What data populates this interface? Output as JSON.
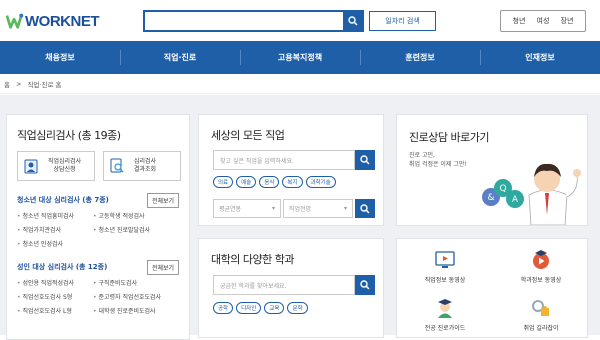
{
  "header": {
    "logo_text": "WORKNET",
    "search_placeholder": "",
    "job_search_label": "일자리 검색",
    "audience": [
      "청년",
      "여성",
      "장년"
    ]
  },
  "nav": [
    "채용정보",
    "직업·진로",
    "고용복지정책",
    "훈련정보",
    "인재정보"
  ],
  "breadcrumb": [
    "홈",
    ">",
    "직업·진로 홈"
  ],
  "psych": {
    "title": "직업심리검사 (총 19종)",
    "btn_apply": "직업심리검사\n상담신청",
    "btn_apply_l1": "직업심리검사",
    "btn_apply_l2": "상담신청",
    "btn_result_l1": "심리검사",
    "btn_result_l2": "결과조회",
    "youth_title": "청소년 대상 심리검사 (총 7종)",
    "youth_all": "전체보기",
    "youth_items": [
      "청소년 직업흥미검사",
      "고등학생 적성검사",
      "직업가치관검사",
      "청소년 진로발달검사",
      "청소년 인성검사"
    ],
    "adult_title": "성인 대상 심리검사 (총 12종)",
    "adult_all": "전체보기",
    "adult_items": [
      "성인용 직업적성검사",
      "구직준비도검사",
      "직업선호도검사 S형",
      "준고령자 직업선호도검사",
      "직업선호도검사 L형",
      "대학생 진로준비도검사"
    ]
  },
  "jobs": {
    "title": "세상의 모든 직업",
    "placeholder": "찾고 싶은 직업을 입력하세요.",
    "tags": [
      "의료",
      "예술",
      "음식",
      "복지",
      "과학기술"
    ],
    "select1": "평균연봉",
    "select2": "직업전망"
  },
  "majors": {
    "title": "대학의 다양한 학과",
    "placeholder": "궁금한 학과를 찾아보세요.",
    "tags": [
      "공학",
      "디자인",
      "교육",
      "문학"
    ]
  },
  "counsel": {
    "title": "진로상담 바로가기",
    "desc_l1": "진로 고민,",
    "desc_l2": "취업 걱정은 이제 그만!",
    "bubbles": [
      "Q",
      "&",
      "A"
    ]
  },
  "quicklinks": [
    "직업정보 동영상",
    "학과정보 동영상",
    "전공 진로가이드",
    "취업 길라잡이"
  ],
  "colors": {
    "primary": "#1f5fa8",
    "logo_green": "#4caf50",
    "bg": "#eef0f3"
  }
}
